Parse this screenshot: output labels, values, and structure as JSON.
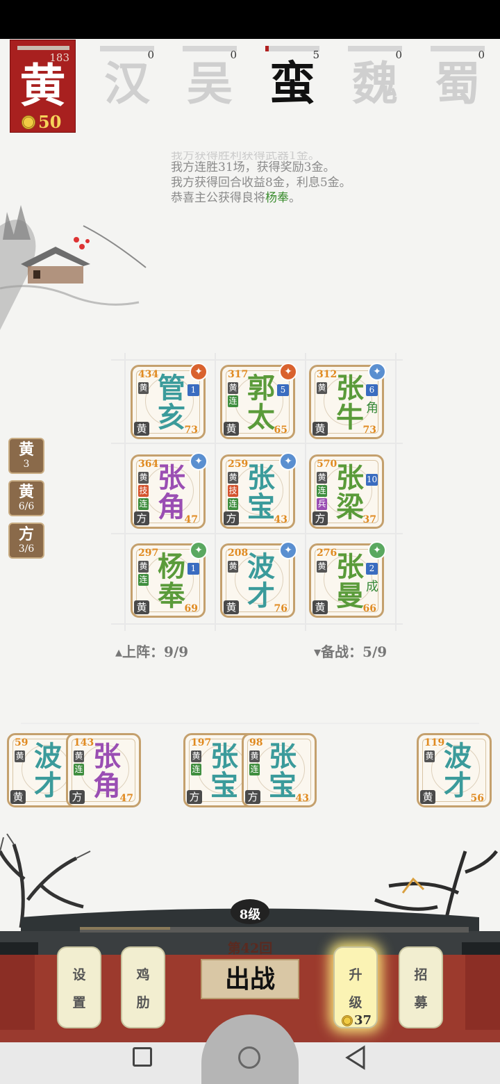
{
  "player": {
    "faction_char": "黄",
    "hp": "183",
    "gold": "50"
  },
  "factions": [
    {
      "char": "汉",
      "count": "0"
    },
    {
      "char": "吴",
      "count": "0"
    },
    {
      "char": "蛮",
      "count": "5"
    },
    {
      "char": "魏",
      "count": "0"
    },
    {
      "char": "蜀",
      "count": "0"
    }
  ],
  "log": {
    "faded": "我方获得胜利获得武器1金。",
    "line1": "我方连胜31场，获得奖励3金。",
    "line2": "我方获得回合收益8金，利息5金。",
    "line3_pre": "恭喜主公获得良将",
    "line3_name": "杨奉",
    "line3_post": "。"
  },
  "side_buttons": [
    {
      "title": "黄",
      "sub": "3"
    },
    {
      "title": "黄",
      "sub": "6/6"
    },
    {
      "title": "方",
      "sub": "3/6"
    }
  ],
  "board": [
    {
      "name1": "管",
      "name2": "亥",
      "hp": "434",
      "tags": [
        "黄"
      ],
      "level": "1",
      "extra": "",
      "faction": "黄",
      "power": "73",
      "color": "teal",
      "item_color": "#d9622e",
      "item_icon": "gourd-icon"
    },
    {
      "name1": "郭",
      "name2": "太",
      "hp": "317",
      "tags": [
        "黄",
        "连"
      ],
      "level": "5",
      "extra": "",
      "faction": "黄",
      "power": "65",
      "color": "green",
      "item_color": "#d9622e",
      "item_icon": "horse-icon"
    },
    {
      "name1": "张",
      "name2": "牛",
      "hp": "312",
      "tags": [
        "黄"
      ],
      "level": "6",
      "extra": "角",
      "faction": "黄",
      "power": "73",
      "color": "green",
      "item_color": "#5a8fd0",
      "item_icon": "sword-icon"
    },
    {
      "name1": "张",
      "name2": "角",
      "hp": "364",
      "tags": [
        "黄",
        "技",
        "连"
      ],
      "level": "",
      "extra": "",
      "faction": "方",
      "power": "47",
      "color": "purple",
      "item_color": "#5a8fd0",
      "item_icon": "bow-icon"
    },
    {
      "name1": "张",
      "name2": "宝",
      "hp": "259",
      "tags": [
        "黄",
        "技",
        "连"
      ],
      "level": "",
      "extra": "",
      "faction": "方",
      "power": "43",
      "color": "teal",
      "item_color": "#5a8fd0",
      "item_icon": "sword-icon"
    },
    {
      "name1": "张",
      "name2": "梁",
      "hp": "570",
      "tags": [
        "黄",
        "连",
        "兵"
      ],
      "level": "10",
      "extra": "",
      "faction": "方",
      "power": "37",
      "color": "green",
      "item_color": "",
      "item_icon": ""
    },
    {
      "name1": "杨",
      "name2": "奉",
      "hp": "297",
      "tags": [
        "黄",
        "连"
      ],
      "level": "1",
      "extra": "",
      "faction": "黄",
      "power": "69",
      "color": "green",
      "item_color": "#5aa860",
      "item_icon": "axes-icon"
    },
    {
      "name1": "波",
      "name2": "才",
      "hp": "208",
      "tags": [
        "黄"
      ],
      "level": "",
      "extra": "",
      "faction": "黄",
      "power": "76",
      "color": "teal",
      "item_color": "#5a8fd0",
      "item_icon": "shield-icon"
    },
    {
      "name1": "张",
      "name2": "曼",
      "hp": "276",
      "tags": [
        "黄"
      ],
      "level": "2",
      "extra": "成",
      "faction": "黄",
      "power": "66",
      "color": "green",
      "item_color": "#5aa860",
      "item_icon": "armor-icon"
    }
  ],
  "counters": {
    "deployed": "▴上阵：9/9",
    "reserve": "▾备战：5/9"
  },
  "bench": [
    {
      "name1": "波",
      "name2": "才",
      "hp": "59",
      "tags": [
        "黄"
      ],
      "faction": "黄",
      "power": "5",
      "color": "teal"
    },
    {
      "name1": "张",
      "name2": "角",
      "hp": "143",
      "tags": [
        "黄",
        "连"
      ],
      "faction": "方",
      "power": "47",
      "color": "purple"
    },
    {
      "name1": "张",
      "name2": "宝",
      "hp": "197",
      "tags": [
        "黄",
        "连"
      ],
      "faction": "方",
      "power": "4",
      "color": "teal"
    },
    {
      "name1": "张",
      "name2": "宝",
      "hp": "98",
      "tags": [
        "黄",
        "连"
      ],
      "faction": "方",
      "power": "43",
      "color": "teal"
    },
    {
      "name1": "波",
      "name2": "才",
      "hp": "119",
      "tags": [
        "黄"
      ],
      "faction": "黄",
      "power": "56",
      "color": "teal"
    }
  ],
  "bottom": {
    "level": "8级",
    "round": "第42回",
    "fight": "出战",
    "settings": [
      "设",
      "置"
    ],
    "chicken": [
      "鸡",
      "肋"
    ],
    "upgrade": [
      "升",
      "级"
    ],
    "upgrade_cost": "37",
    "recruit": [
      "招",
      "募"
    ]
  }
}
